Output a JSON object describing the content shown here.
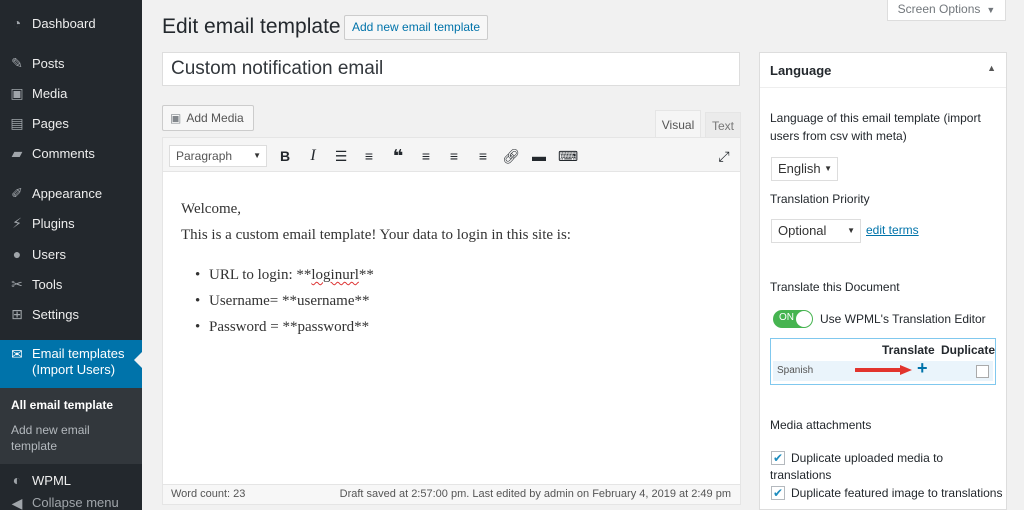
{
  "sidebar": {
    "items": [
      {
        "label": "Dashboard",
        "icon": "dashboard-icon"
      },
      {
        "label": "Posts",
        "icon": "pin-icon"
      },
      {
        "label": "Media",
        "icon": "media-icon"
      },
      {
        "label": "Pages",
        "icon": "pages-icon"
      },
      {
        "label": "Comments",
        "icon": "comments-icon"
      },
      {
        "label": "Appearance",
        "icon": "brush-icon"
      },
      {
        "label": "Plugins",
        "icon": "plugin-icon"
      },
      {
        "label": "Users",
        "icon": "users-icon"
      },
      {
        "label": "Tools",
        "icon": "wrench-icon"
      },
      {
        "label": "Settings",
        "icon": "settings-icon"
      }
    ],
    "current": {
      "label_line1": "Email templates",
      "label_line2": "(Import Users)",
      "icon": "mail-icon"
    },
    "submenu": {
      "all": "All email template",
      "add_line1": "Add new email",
      "add_line2": "template"
    },
    "wpml": "WPML",
    "collapse": "Collapse menu"
  },
  "header": {
    "title": "Edit email template",
    "add_new": "Add new email template",
    "screen_options": "Screen Options"
  },
  "post": {
    "title": "Custom notification email"
  },
  "editor": {
    "add_media": "Add Media",
    "tab_visual": "Visual",
    "tab_text": "Text",
    "format": "Paragraph",
    "content": {
      "line1": "Welcome,",
      "line2": "This is a custom email template! Your data to login in this site is:",
      "b1_prefix": "URL to login: **",
      "b1_word": "loginurl",
      "b1_suffix": "**",
      "b2": "Username= **username**",
      "b3": "Password = **password**"
    },
    "word_count": "Word count: 23",
    "saved": "Draft saved at 2:57:00 pm. Last edited by admin on February 4, 2019 at 2:49 pm"
  },
  "language_box": {
    "title": "Language",
    "lang_label_1": "Language of this email template (import",
    "lang_label_2": "users from csv with meta)",
    "language": "English",
    "priority_label": "Translation Priority",
    "priority": "Optional",
    "edit_terms": "edit terms",
    "translate_doc": "Translate this Document",
    "toggle_on": "ON",
    "toggle_label": "Use WPML's Translation Editor",
    "col_translate": "Translate",
    "col_duplicate": "Duplicate",
    "row_language": "Spanish",
    "media_title": "Media attachments",
    "dup_media_1": "Duplicate uploaded media to",
    "dup_media_2": "translations",
    "dup_featured": "Duplicate featured image to translations"
  },
  "colors": {
    "accent": "#0073aa",
    "sidebar_bg": "#23282d",
    "toggle_on": "#46b450",
    "arrow": "#e2342d"
  }
}
